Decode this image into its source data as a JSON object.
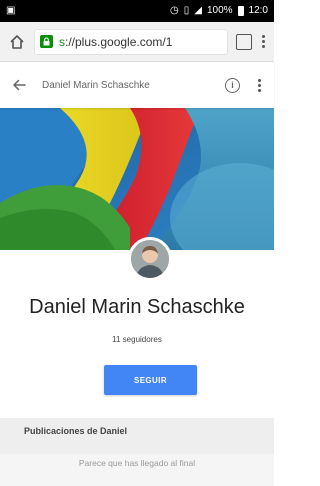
{
  "status_bar": {
    "battery_percent": "100%",
    "time": "12:0"
  },
  "browser": {
    "url_scheme": "s",
    "url_rest": "://plus.google.com/1",
    "tabs_count": "",
    "lock_color": "#0a8f08"
  },
  "app_bar": {
    "title": "Daniel Marin Schaschke"
  },
  "profile": {
    "name": "Daniel Marin Schaschke",
    "followers": "11 seguidores",
    "follow_label": "SEGUIR",
    "accent": "#4285f4"
  },
  "posts": {
    "section_title": "Publicaciones de Daniel",
    "end_message": "Parece que has llegado al final"
  }
}
